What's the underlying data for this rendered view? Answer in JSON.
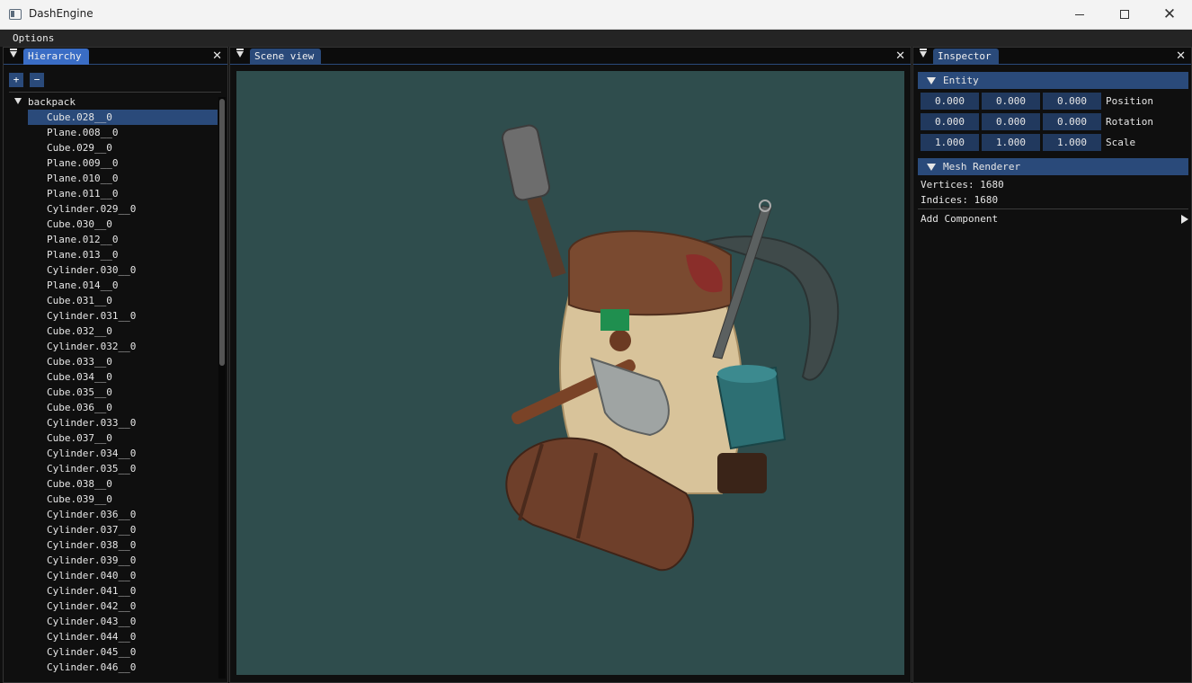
{
  "window": {
    "title": "DashEngine"
  },
  "menu": {
    "options": "Options"
  },
  "hierarchy": {
    "tab": "Hierarchy",
    "close": "✕",
    "add_label": "+",
    "remove_label": "−",
    "root": "backpack",
    "items": [
      "Cube.028__0",
      "Plane.008__0",
      "Cube.029__0",
      "Plane.009__0",
      "Plane.010__0",
      "Plane.011__0",
      "Cylinder.029__0",
      "Cube.030__0",
      "Plane.012__0",
      "Plane.013__0",
      "Cylinder.030__0",
      "Plane.014__0",
      "Cube.031__0",
      "Cylinder.031__0",
      "Cube.032__0",
      "Cylinder.032__0",
      "Cube.033__0",
      "Cube.034__0",
      "Cube.035__0",
      "Cube.036__0",
      "Cylinder.033__0",
      "Cube.037__0",
      "Cylinder.034__0",
      "Cylinder.035__0",
      "Cube.038__0",
      "Cube.039__0",
      "Cylinder.036__0",
      "Cylinder.037__0",
      "Cylinder.038__0",
      "Cylinder.039__0",
      "Cylinder.040__0",
      "Cylinder.041__0",
      "Cylinder.042__0",
      "Cylinder.043__0",
      "Cylinder.044__0",
      "Cylinder.045__0",
      "Cylinder.046__0"
    ],
    "selected_index": 0
  },
  "scene": {
    "tab": "Scene view",
    "close": "✕"
  },
  "inspector": {
    "tab": "Inspector",
    "close": "✕",
    "entity": {
      "header": "Entity",
      "position": {
        "label": "Position",
        "x": "0.000",
        "y": "0.000",
        "z": "0.000"
      },
      "rotation": {
        "label": "Rotation",
        "x": "0.000",
        "y": "0.000",
        "z": "0.000"
      },
      "scale": {
        "label": "Scale",
        "x": "1.000",
        "y": "1.000",
        "z": "1.000"
      }
    },
    "mesh_renderer": {
      "header": "Mesh Renderer",
      "vertices": "Vertices: 1680",
      "indices": "Indices: 1680"
    },
    "add_component": "Add Component"
  },
  "colors": {
    "tab_active": "#3a6dc5",
    "tab_inactive": "#2a4a7a",
    "field_bg": "#21395e",
    "viewport_bg": "#2f4d4d"
  }
}
